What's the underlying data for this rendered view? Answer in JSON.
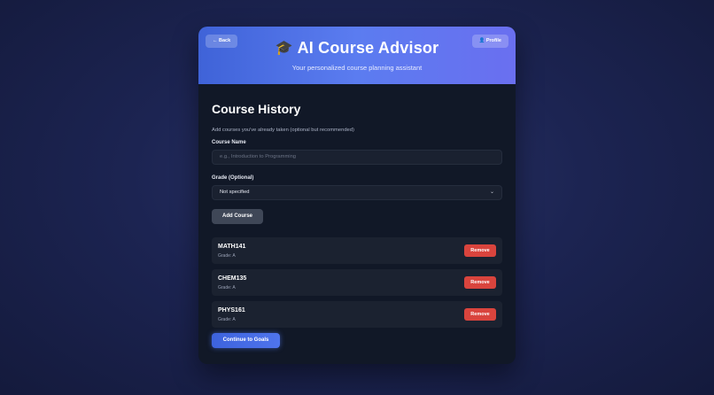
{
  "header": {
    "back_label": "← Back",
    "profile_label": "👤 Profile",
    "title_icon": "🎓",
    "title": "AI Course Advisor",
    "subtitle": "Your personalized course planning assistant",
    "gradient_start": "#3f63d8",
    "gradient_end": "#6a6ff0"
  },
  "main": {
    "section_title": "Course History",
    "helper_text": "Add courses you've already taken (optional but recommended)",
    "course_name_label": "Course Name",
    "course_name_placeholder": "e.g., Introduction to Programming",
    "course_name_value": "",
    "grade_label": "Grade (Optional)",
    "grade_selected": "Not specified",
    "add_button": "Add Course",
    "courses": [
      {
        "code": "MATH141",
        "grade": "Grade: A",
        "remove": "Remove"
      },
      {
        "code": "CHEM135",
        "grade": "Grade: A",
        "remove": "Remove"
      },
      {
        "code": "PHYS161",
        "grade": "Grade: A",
        "remove": "Remove"
      }
    ],
    "continue_button": "Continue to Goals"
  },
  "colors": {
    "accent": "#4f74ec",
    "danger": "#d9443d",
    "card_bg": "#111827"
  }
}
